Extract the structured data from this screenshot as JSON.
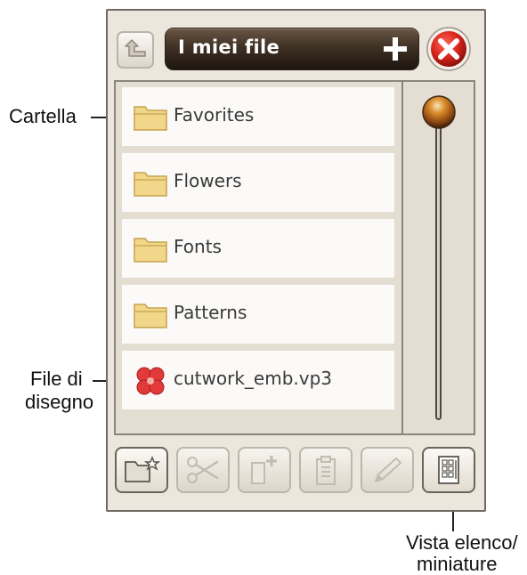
{
  "annotations": {
    "folder_label": "Cartella",
    "design_file_label_line1": "File di",
    "design_file_label_line2": "disegno",
    "view_toggle_label_line1": "Vista elenco/",
    "view_toggle_label_line2": "miniature"
  },
  "window": {
    "title": "I miei file"
  },
  "files": [
    {
      "name": "Favorites",
      "type": "folder"
    },
    {
      "name": "Flowers",
      "type": "folder"
    },
    {
      "name": "Fonts",
      "type": "folder"
    },
    {
      "name": "Patterns",
      "type": "folder"
    },
    {
      "name": "cutwork_emb.vp3",
      "type": "design"
    }
  ],
  "toolbar": {
    "buttons": [
      {
        "icon": "new-folder-icon",
        "enabled": true
      },
      {
        "icon": "scissors-icon",
        "enabled": false
      },
      {
        "icon": "copy-icon",
        "enabled": false
      },
      {
        "icon": "paste-icon",
        "enabled": false
      },
      {
        "icon": "pencil-icon",
        "enabled": false
      },
      {
        "icon": "list-thumbnail-view-icon",
        "enabled": true
      }
    ]
  },
  "colors": {
    "title_bar": "#3f3125",
    "close_button": "#d8241c",
    "scroll_thumb": "#c47a20",
    "folder": "#f2d78a",
    "design_icon": "#e23a3a"
  }
}
